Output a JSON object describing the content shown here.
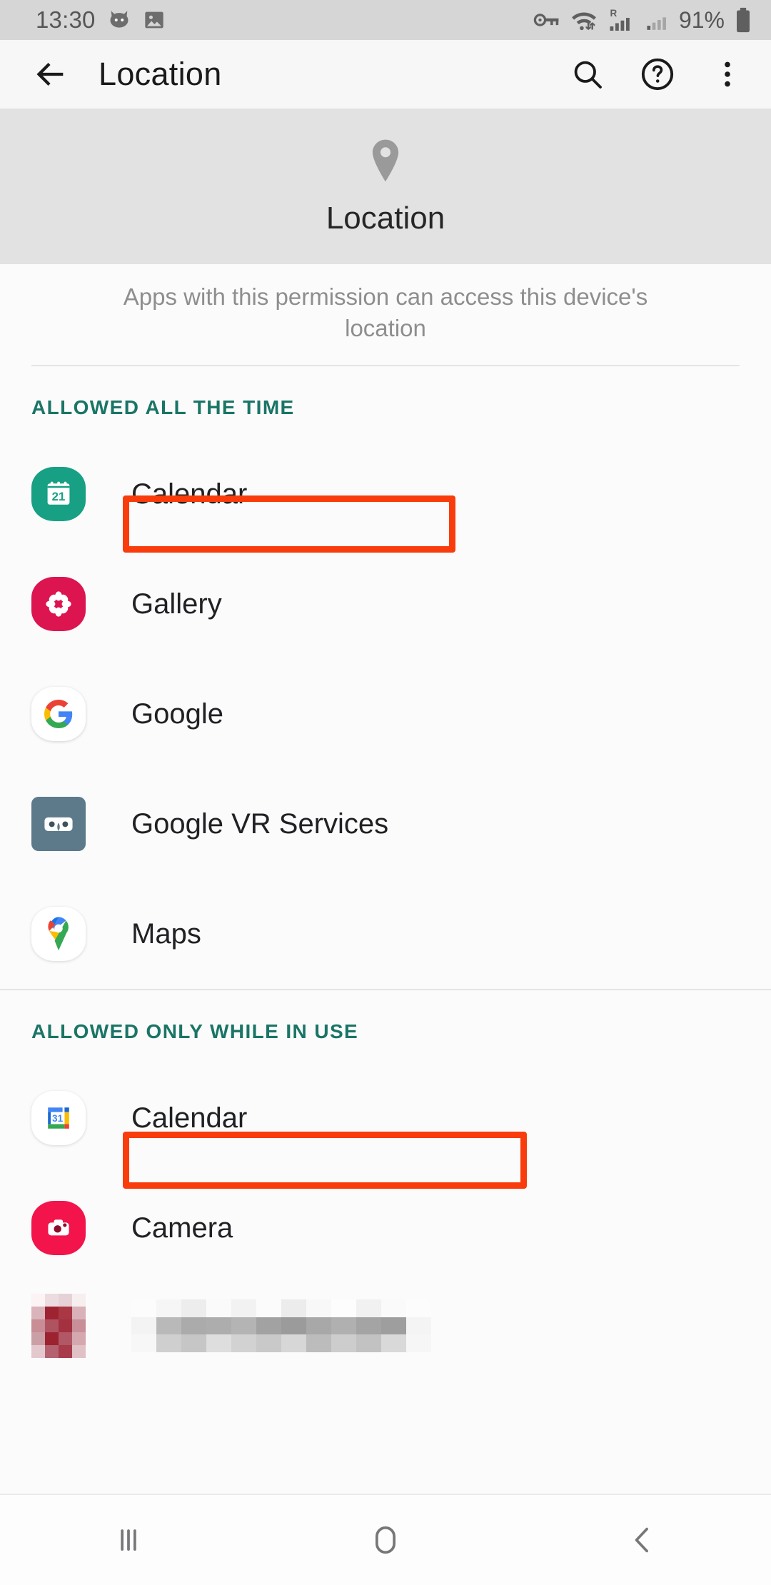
{
  "status_bar": {
    "time": "13:30",
    "battery_percent": "91%",
    "icons": [
      "cat-face-icon",
      "image-icon",
      "vpn-key-icon",
      "wifi-icon",
      "roaming-signal-icon",
      "signal-icon",
      "battery-icon"
    ],
    "roaming_label": "R",
    "background": "#d6d6d6"
  },
  "toolbar": {
    "title": "Location",
    "back_icon": "back-arrow-icon",
    "search_icon": "search-icon",
    "help_icon": "help-circle-icon",
    "more_icon": "overflow-menu-icon"
  },
  "banner": {
    "title": "Location",
    "icon": "location-pin-icon",
    "background": "#e2e2e2"
  },
  "description": "Apps with this permission can access this device's location",
  "accent_color": "#1a7566",
  "annotation_color": "#f93c0c",
  "sections": [
    {
      "header": "ALLOWED ALL THE TIME",
      "annotated": true,
      "apps": [
        {
          "name": "Calendar",
          "icon": "samsung-calendar-icon",
          "badge": "21"
        },
        {
          "name": "Gallery",
          "icon": "samsung-gallery-icon"
        },
        {
          "name": "Google",
          "icon": "google-g-icon"
        },
        {
          "name": "Google VR Services",
          "icon": "google-vr-icon"
        },
        {
          "name": "Maps",
          "icon": "google-maps-pin-icon"
        }
      ]
    },
    {
      "header": "ALLOWED ONLY WHILE IN USE",
      "annotated": true,
      "apps": [
        {
          "name": "Calendar",
          "icon": "google-calendar-icon",
          "badge": "31"
        },
        {
          "name": "Camera",
          "icon": "samsung-camera-icon"
        }
      ]
    }
  ],
  "redacted_row": {
    "label": "redacted-app-row"
  },
  "nav_bar": {
    "recents_label": "recents-icon",
    "home_label": "home-icon",
    "back_label": "back-icon"
  }
}
